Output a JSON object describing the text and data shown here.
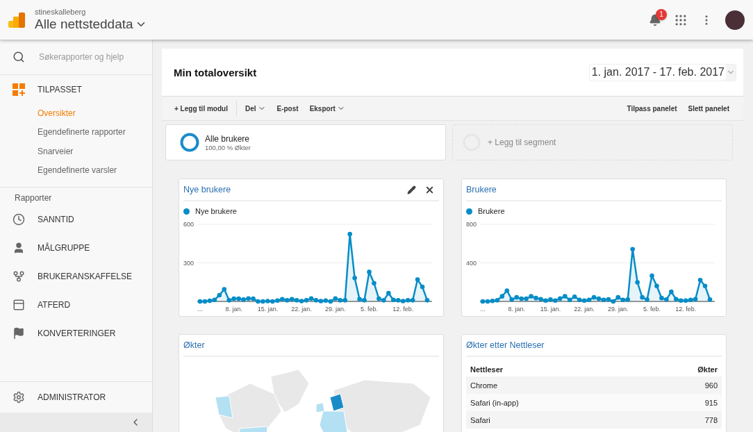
{
  "topbar": {
    "account": "stineskalleberg",
    "property": "Alle nettsteddata",
    "notifications": "1"
  },
  "sidebar": {
    "search": {
      "placeholder": "Søkerapporter og hjelp"
    },
    "custom": {
      "label": "TILPASSET",
      "items": [
        {
          "label": "Oversikter",
          "selected": true
        },
        {
          "label": "Egendefinerte rapporter",
          "selected": false
        },
        {
          "label": "Snarveier",
          "selected": false
        },
        {
          "label": "Egendefinerte varsler",
          "selected": false
        }
      ]
    },
    "reports_heading": "Rapporter",
    "reports": [
      {
        "label": "SANNTID",
        "kind": "clock"
      },
      {
        "label": "MÅLGRUPPE",
        "kind": "person"
      },
      {
        "label": "BRUKERANSKAFFELSE",
        "kind": "branch"
      },
      {
        "label": "ATFERD",
        "kind": "window"
      },
      {
        "label": "KONVERTERINGER",
        "kind": "flag"
      }
    ],
    "admin": "ADMINISTRATOR"
  },
  "dashboard": {
    "title": "Min totaloversikt",
    "date_range": "1. jan. 2017 - 17. feb. 2017",
    "toolbar_left": [
      {
        "label": "+ Legg til modul",
        "dropdown": false
      },
      {
        "label": "Del",
        "dropdown": true
      },
      {
        "label": "E-post",
        "dropdown": false
      },
      {
        "label": "Eksport",
        "dropdown": true
      }
    ],
    "toolbar_right": [
      "Tilpass panelet",
      "Slett panelet"
    ],
    "segments": [
      {
        "name": "Alle brukere",
        "detail": "100,00 % Økter"
      }
    ],
    "add_segment": "+ Legg til segment"
  },
  "widgets": [
    {
      "kind": "chart",
      "title": "Nye brukere",
      "controls": true,
      "chart_data": {
        "type": "area",
        "categories": [
          "...",
          null,
          null,
          null,
          null,
          null,
          null,
          "8. jan.",
          null,
          null,
          null,
          null,
          null,
          null,
          "15. jan.",
          null,
          null,
          null,
          null,
          null,
          null,
          "22. jan.",
          null,
          null,
          null,
          null,
          null,
          null,
          "29. jan.",
          null,
          null,
          null,
          null,
          null,
          null,
          "5. feb.",
          null,
          null,
          null,
          null,
          null,
          null,
          "12. feb.",
          null,
          null,
          null,
          null,
          null
        ],
        "series": [
          {
            "name": "Nye brukere",
            "color": "#058dc7",
            "values": [
              0,
              0,
              5,
              12,
              49,
              95,
              9,
              21,
              21,
              14,
              23,
              21,
              0,
              0,
              3,
              0,
              7,
              17,
              9,
              17,
              9,
              3,
              9,
              23,
              9,
              3,
              7,
              0,
              23,
              9,
              9,
              524,
              182,
              17,
              9,
              229,
              142,
              21,
              9,
              64,
              12,
              9,
              3,
              9,
              9,
              170,
              113,
              9
            ]
          }
        ],
        "ylim": [
          0,
          600
        ],
        "yticks": [
          300,
          600
        ]
      }
    },
    {
      "kind": "chart",
      "title": "Brukere",
      "controls": false,
      "chart_data": {
        "type": "area",
        "categories": [
          "...",
          null,
          null,
          null,
          null,
          null,
          null,
          "8. jan.",
          null,
          null,
          null,
          null,
          null,
          null,
          "15. jan.",
          null,
          null,
          null,
          null,
          null,
          null,
          "22. jan.",
          null,
          null,
          null,
          null,
          null,
          null,
          "29. jan.",
          null,
          null,
          null,
          null,
          null,
          null,
          "5. feb.",
          null,
          null,
          null,
          null,
          null,
          null,
          "12. feb.",
          null,
          null,
          null,
          null,
          null
        ],
        "series": [
          {
            "name": "Brukere",
            "color": "#058dc7",
            "values": [
              0,
              0,
              5,
              12,
              53,
              112,
              19,
              42,
              28,
              28,
              53,
              35,
              23,
              9,
              19,
              9,
              30,
              53,
              16,
              49,
              16,
              9,
              16,
              42,
              28,
              16,
              21,
              0,
              42,
              16,
              19,
              542,
              198,
              42,
              19,
              267,
              160,
              35,
              19,
              100,
              23,
              9,
              9,
              16,
              23,
              221,
              160,
              19
            ]
          }
        ],
        "ylim": [
          0,
          800
        ],
        "yticks": [
          400,
          800
        ]
      }
    },
    {
      "kind": "map",
      "title": "Økter",
      "controls": false
    },
    {
      "kind": "table",
      "title": "Økter etter Nettleser",
      "controls": false,
      "columns": [
        "Nettleser",
        "Økter"
      ],
      "rows": [
        [
          "Chrome",
          "960"
        ],
        [
          "Safari (in-app)",
          "915"
        ],
        [
          "Safari",
          "778"
        ]
      ]
    }
  ]
}
